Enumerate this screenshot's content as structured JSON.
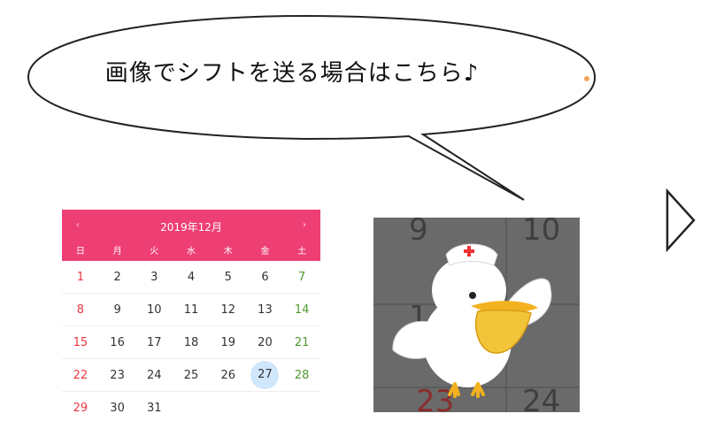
{
  "bubble": {
    "text": "画像でシフトを送る場合はこちら♪"
  },
  "calendar": {
    "header_title": "2019年12月",
    "prev_label": "‹",
    "next_label": "›",
    "weekdays": [
      "日",
      "月",
      "火",
      "水",
      "木",
      "金",
      "土"
    ],
    "weeks": [
      [
        "1",
        "2",
        "3",
        "4",
        "5",
        "6",
        "7"
      ],
      [
        "8",
        "9",
        "10",
        "11",
        "12",
        "13",
        "14"
      ],
      [
        "15",
        "16",
        "17",
        "18",
        "19",
        "20",
        "21"
      ],
      [
        "22",
        "23",
        "24",
        "25",
        "26",
        "27",
        "28"
      ],
      [
        "29",
        "30",
        "31",
        "",
        "",
        "",
        ""
      ]
    ],
    "today": "27",
    "colors": {
      "header": "#ee3f74",
      "sunday": "#e8373e",
      "saturday": "#4f9a2f",
      "today_highlight": "#cfe6fb"
    }
  },
  "image": {
    "background_numbers": [
      "9",
      "10",
      "1",
      "23",
      "24"
    ],
    "icon": "pelican-nurse-icon"
  },
  "arrow": {
    "icon": "play-arrow-outline-icon"
  }
}
